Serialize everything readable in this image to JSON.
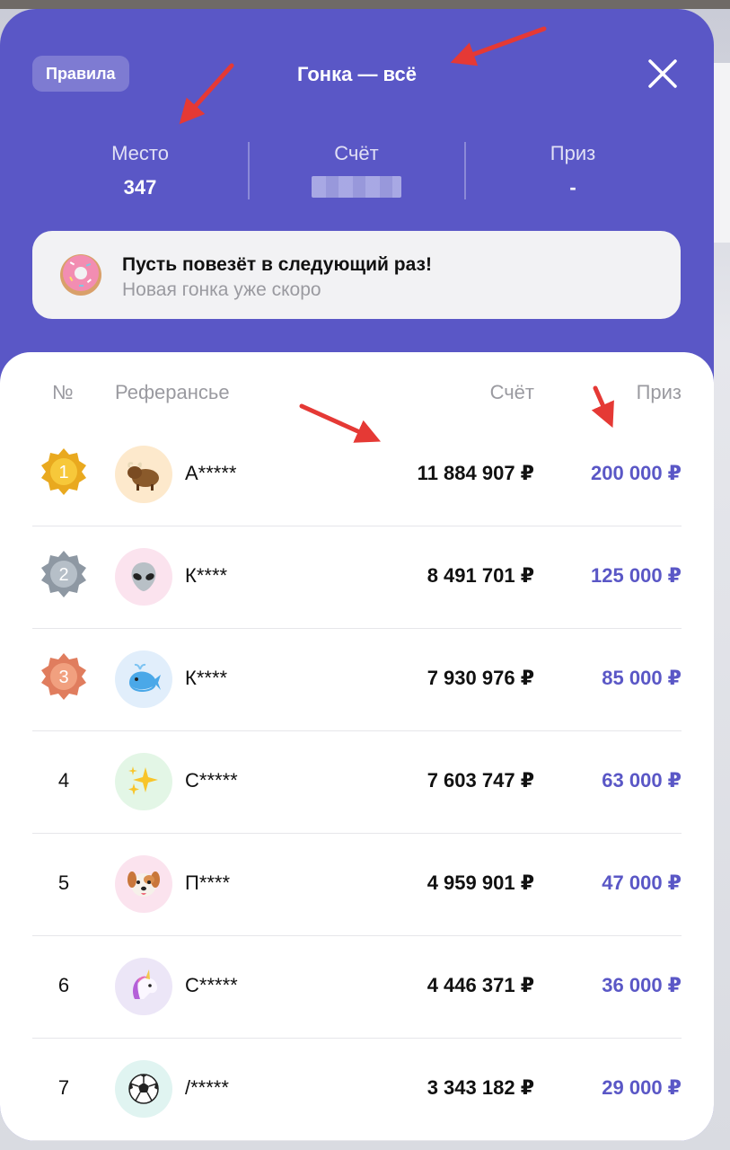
{
  "header": {
    "rules_label": "Правила",
    "title": "Гонка — всё"
  },
  "stats": {
    "place_label": "Место",
    "place_value": "347",
    "score_label": "Счёт",
    "prize_label": "Приз",
    "prize_value": "-"
  },
  "banner": {
    "title": "Пусть повезёт в следующий раз!",
    "subtitle": "Новая гонка уже скоро"
  },
  "table": {
    "columns": {
      "rank": "№",
      "player": "Реферансье",
      "score": "Счёт",
      "prize": "Приз"
    },
    "rows": [
      {
        "rank": "1",
        "name": "А*****",
        "score": "11 884 907 ₽",
        "prize": "200 000 ₽",
        "medal": "gold",
        "avatar": "yak-icon"
      },
      {
        "rank": "2",
        "name": "К****",
        "score": "8 491 701 ₽",
        "prize": "125 000 ₽",
        "medal": "silver",
        "avatar": "alien-icon"
      },
      {
        "rank": "3",
        "name": "К****",
        "score": "7 930 976 ₽",
        "prize": "85 000 ₽",
        "medal": "bronze",
        "avatar": "whale-icon"
      },
      {
        "rank": "4",
        "name": "С*****",
        "score": "7 603 747 ₽",
        "prize": "63 000 ₽",
        "medal": "",
        "avatar": "sparkles-icon"
      },
      {
        "rank": "5",
        "name": "П****",
        "score": "4 959 901 ₽",
        "prize": "47 000 ₽",
        "medal": "",
        "avatar": "dog-icon"
      },
      {
        "rank": "6",
        "name": "С*****",
        "score": "4 446 371 ₽",
        "prize": "36 000 ₽",
        "medal": "",
        "avatar": "unicorn-icon"
      },
      {
        "rank": "7",
        "name": "/*****",
        "score": "3 343 182 ₽",
        "prize": "29 000 ₽",
        "medal": "",
        "avatar": "soccer-ball-icon"
      }
    ]
  },
  "colors": {
    "accent": "#5a57c6",
    "arrow": "#e53935"
  }
}
